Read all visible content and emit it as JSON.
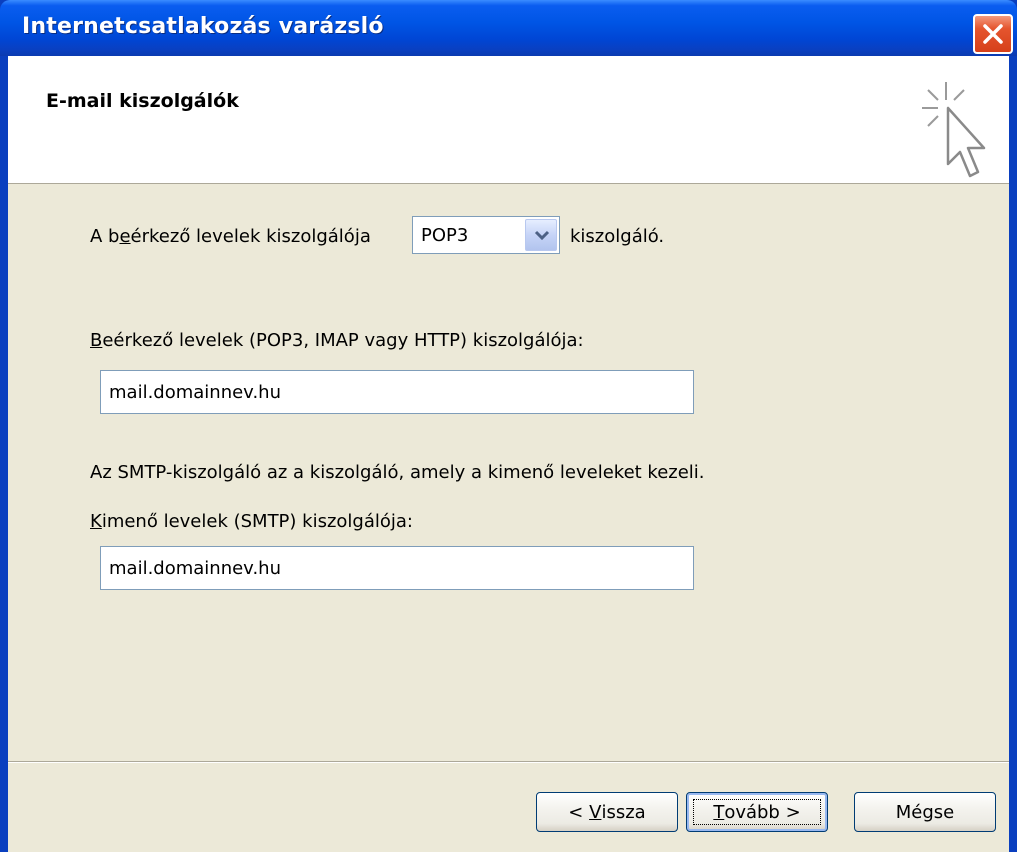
{
  "window": {
    "title": "Internetcsatlakozás varázsló"
  },
  "header": {
    "title": "E-mail kiszolgálók"
  },
  "incoming_type": {
    "label_before_pre": "A b",
    "label_before_ul": "e",
    "label_before_post": "érkező levelek kiszolgálója",
    "value": "POP3",
    "label_after": "kiszolgáló."
  },
  "incoming_server": {
    "label_ul": "B",
    "label_rest": "eérkező levelek (POP3, IMAP vagy HTTP) kiszolgálója:",
    "value": "mail.domainnev.hu"
  },
  "smtp_info": "Az SMTP-kiszolgáló az a kiszolgáló, amely a kimenő leveleket kezeli.",
  "outgoing_server": {
    "label_ul": "K",
    "label_rest": "imenő levelek (SMTP) kiszolgálója:",
    "value": "mail.domainnev.hu"
  },
  "buttons": {
    "back_pre": "< ",
    "back_ul": "V",
    "back_rest": "issza",
    "next_ul": "T",
    "next_rest": "ovább >",
    "cancel": "Mégse"
  }
}
